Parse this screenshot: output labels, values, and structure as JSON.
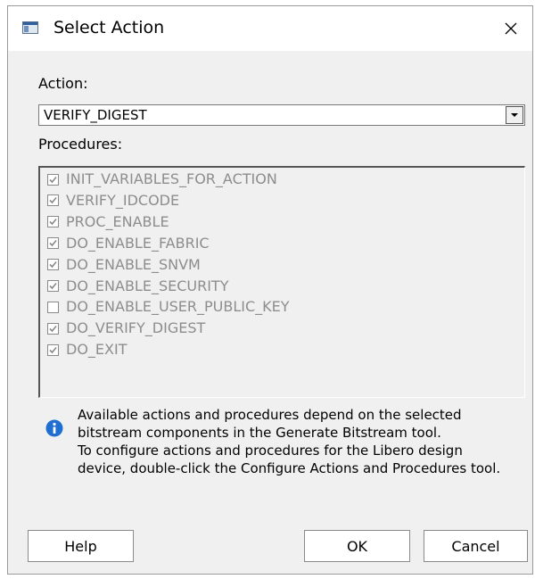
{
  "window": {
    "title": "Select Action",
    "close_glyph": "✕"
  },
  "action": {
    "label": "Action:",
    "selected": "VERIFY_DIGEST"
  },
  "procedures": {
    "label": "Procedures:",
    "items": [
      {
        "label": "INIT_VARIABLES_FOR_ACTION",
        "checked": true
      },
      {
        "label": "VERIFY_IDCODE",
        "checked": true
      },
      {
        "label": "PROC_ENABLE",
        "checked": true
      },
      {
        "label": "DO_ENABLE_FABRIC",
        "checked": true
      },
      {
        "label": "DO_ENABLE_SNVM",
        "checked": true
      },
      {
        "label": "DO_ENABLE_SECURITY",
        "checked": true
      },
      {
        "label": "DO_ENABLE_USER_PUBLIC_KEY",
        "checked": false
      },
      {
        "label": "DO_VERIFY_DIGEST",
        "checked": true
      },
      {
        "label": "DO_EXIT",
        "checked": true
      }
    ]
  },
  "info": {
    "lines": [
      "Available actions and procedures depend on the selected",
      "bitstream components in the Generate Bitstream tool.",
      "To configure actions and procedures for the Libero design",
      "device, double-click the Configure Actions and Procedures tool."
    ]
  },
  "buttons": {
    "help": "Help",
    "ok": "OK",
    "cancel": "Cancel"
  },
  "icons": {
    "app": "window-icon",
    "info": "info-icon",
    "dropdown": "chevron-down-icon",
    "close": "close-icon"
  }
}
